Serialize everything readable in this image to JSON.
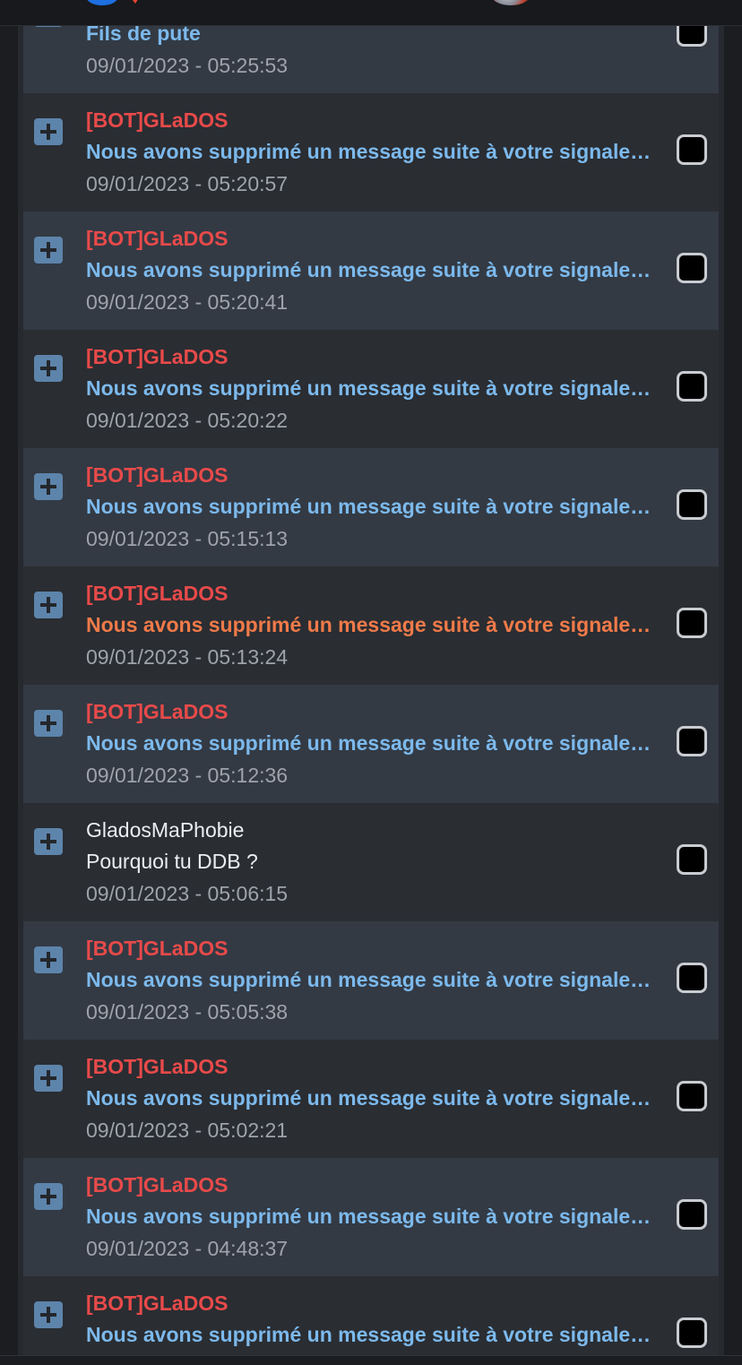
{
  "messages": [
    {
      "author": "",
      "subject": "Fils de pute",
      "date": "09/01/2023 - 05:25:53",
      "subject_color": "blue"
    },
    {
      "author": "[BOT]GLaDOS",
      "subject": "Nous avons supprimé un message suite à votre signalement",
      "date": "09/01/2023 - 05:20:57",
      "subject_color": "blue"
    },
    {
      "author": "[BOT]GLaDOS",
      "subject": "Nous avons supprimé un message suite à votre signalement",
      "date": "09/01/2023 - 05:20:41",
      "subject_color": "blue"
    },
    {
      "author": "[BOT]GLaDOS",
      "subject": "Nous avons supprimé un message suite à votre signalement",
      "date": "09/01/2023 - 05:20:22",
      "subject_color": "blue"
    },
    {
      "author": "[BOT]GLaDOS",
      "subject": "Nous avons supprimé un message suite à votre signalement",
      "date": "09/01/2023 - 05:15:13",
      "subject_color": "blue"
    },
    {
      "author": "[BOT]GLaDOS",
      "subject": "Nous avons supprimé un message suite à votre signalement",
      "date": "09/01/2023 - 05:13:24",
      "subject_color": "orange"
    },
    {
      "author": "[BOT]GLaDOS",
      "subject": "Nous avons supprimé un message suite à votre signalement",
      "date": "09/01/2023 - 05:12:36",
      "subject_color": "blue"
    },
    {
      "author": "GladosMaPhobie",
      "subject": "Pourquoi tu DDB ?",
      "date": "09/01/2023 - 05:06:15",
      "subject_color": "white"
    },
    {
      "author": "[BOT]GLaDOS",
      "subject": "Nous avons supprimé un message suite à votre signalement",
      "date": "09/01/2023 - 05:05:38",
      "subject_color": "blue"
    },
    {
      "author": "[BOT]GLaDOS",
      "subject": "Nous avons supprimé un message suite à votre signalement",
      "date": "09/01/2023 - 05:02:21",
      "subject_color": "blue"
    },
    {
      "author": "[BOT]GLaDOS",
      "subject": "Nous avons supprimé un message suite à votre signalement",
      "date": "09/01/2023 - 04:48:37",
      "subject_color": "blue"
    },
    {
      "author": "[BOT]GLaDOS",
      "subject": "Nous avons supprimé un message suite à votre signalement",
      "date": "",
      "subject_color": "blue"
    }
  ],
  "colors": {
    "bot_author": "#e84a4a",
    "subject_blue": "#7cb9ec",
    "subject_orange": "#f07a49",
    "date": "#9ea3ab",
    "row_alt": "#333a44",
    "row_plain": "#2a2d32"
  },
  "icons": {
    "expand": "plus-square-icon",
    "select": "checkbox-icon"
  }
}
